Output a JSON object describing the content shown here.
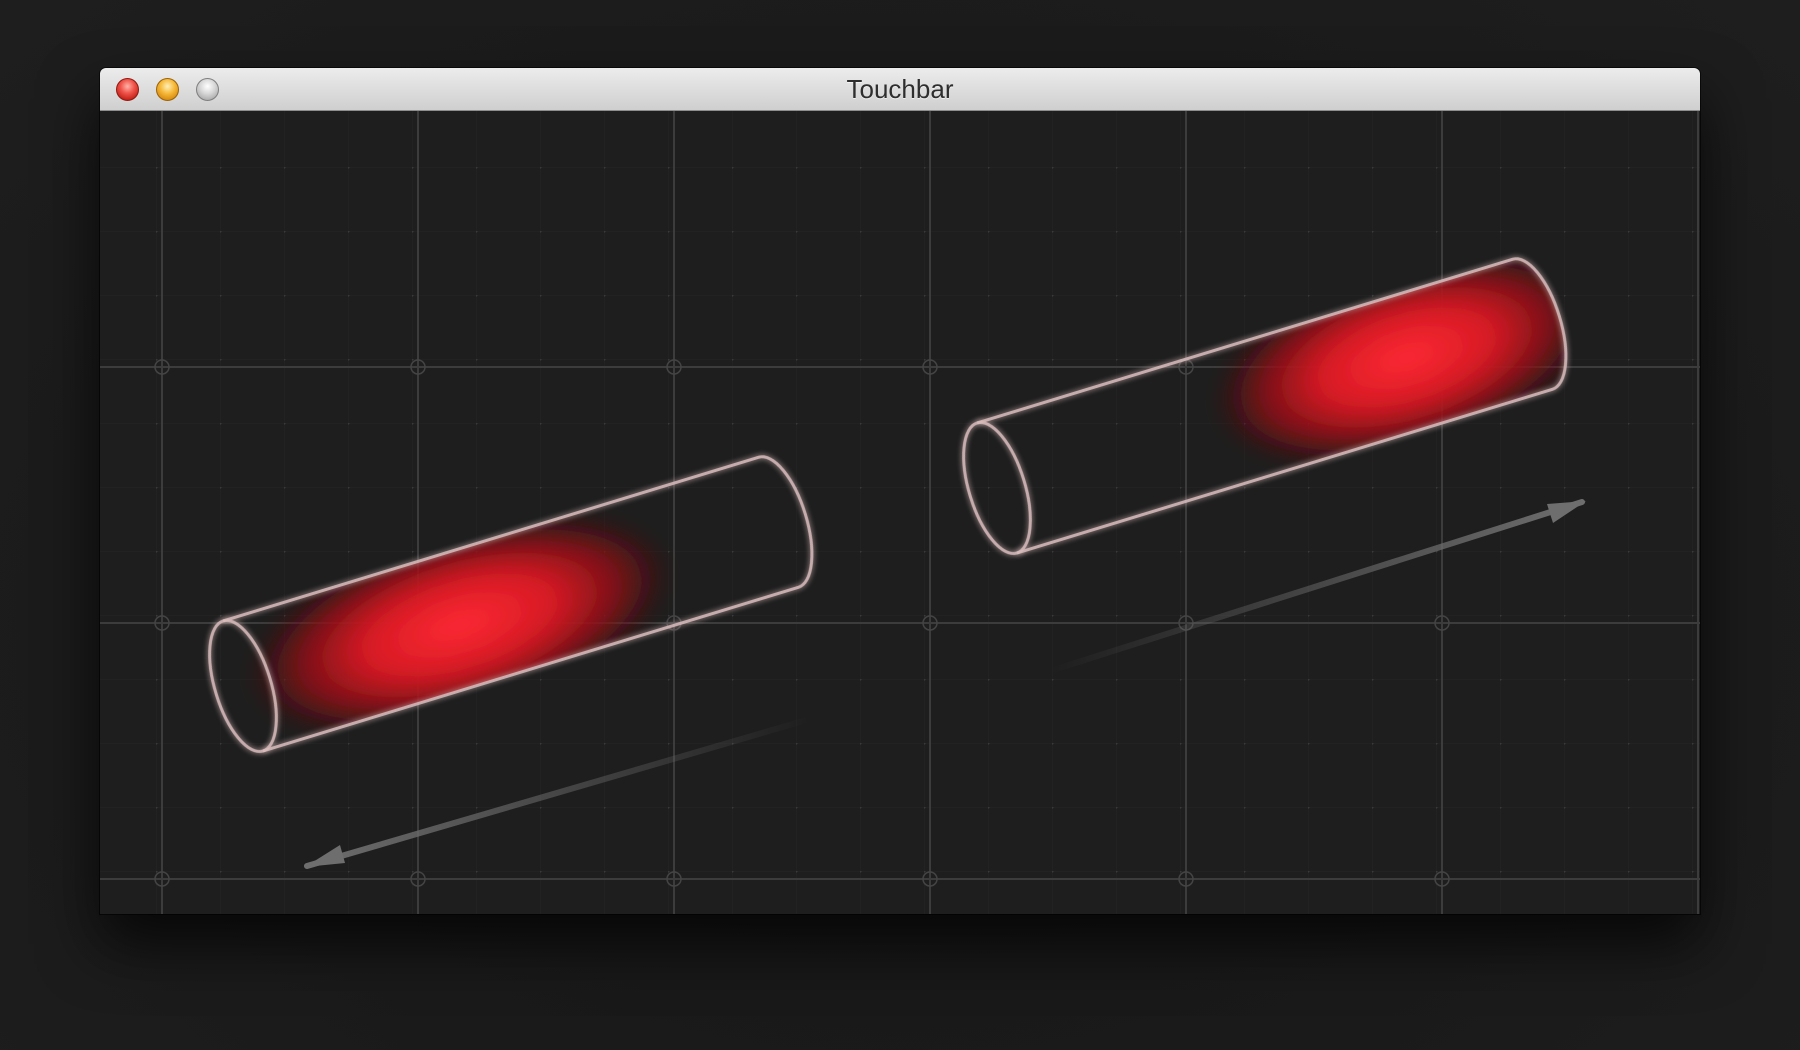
{
  "window": {
    "title": "Touchbar",
    "controls": {
      "close": "close-button",
      "minimize": "minimize-button",
      "zoom": "zoom-button"
    }
  },
  "scene": {
    "background_color": "#1e1e1e",
    "grid_color": "#3a3a3a",
    "bar_outline_color": "#d9bcbc",
    "touch_glow_color": "#e0202a",
    "arrow_color": "#6a6a6a",
    "bars": [
      {
        "name": "left-touchbar",
        "swipe_direction": "left"
      },
      {
        "name": "right-touchbar",
        "swipe_direction": "right"
      }
    ]
  }
}
